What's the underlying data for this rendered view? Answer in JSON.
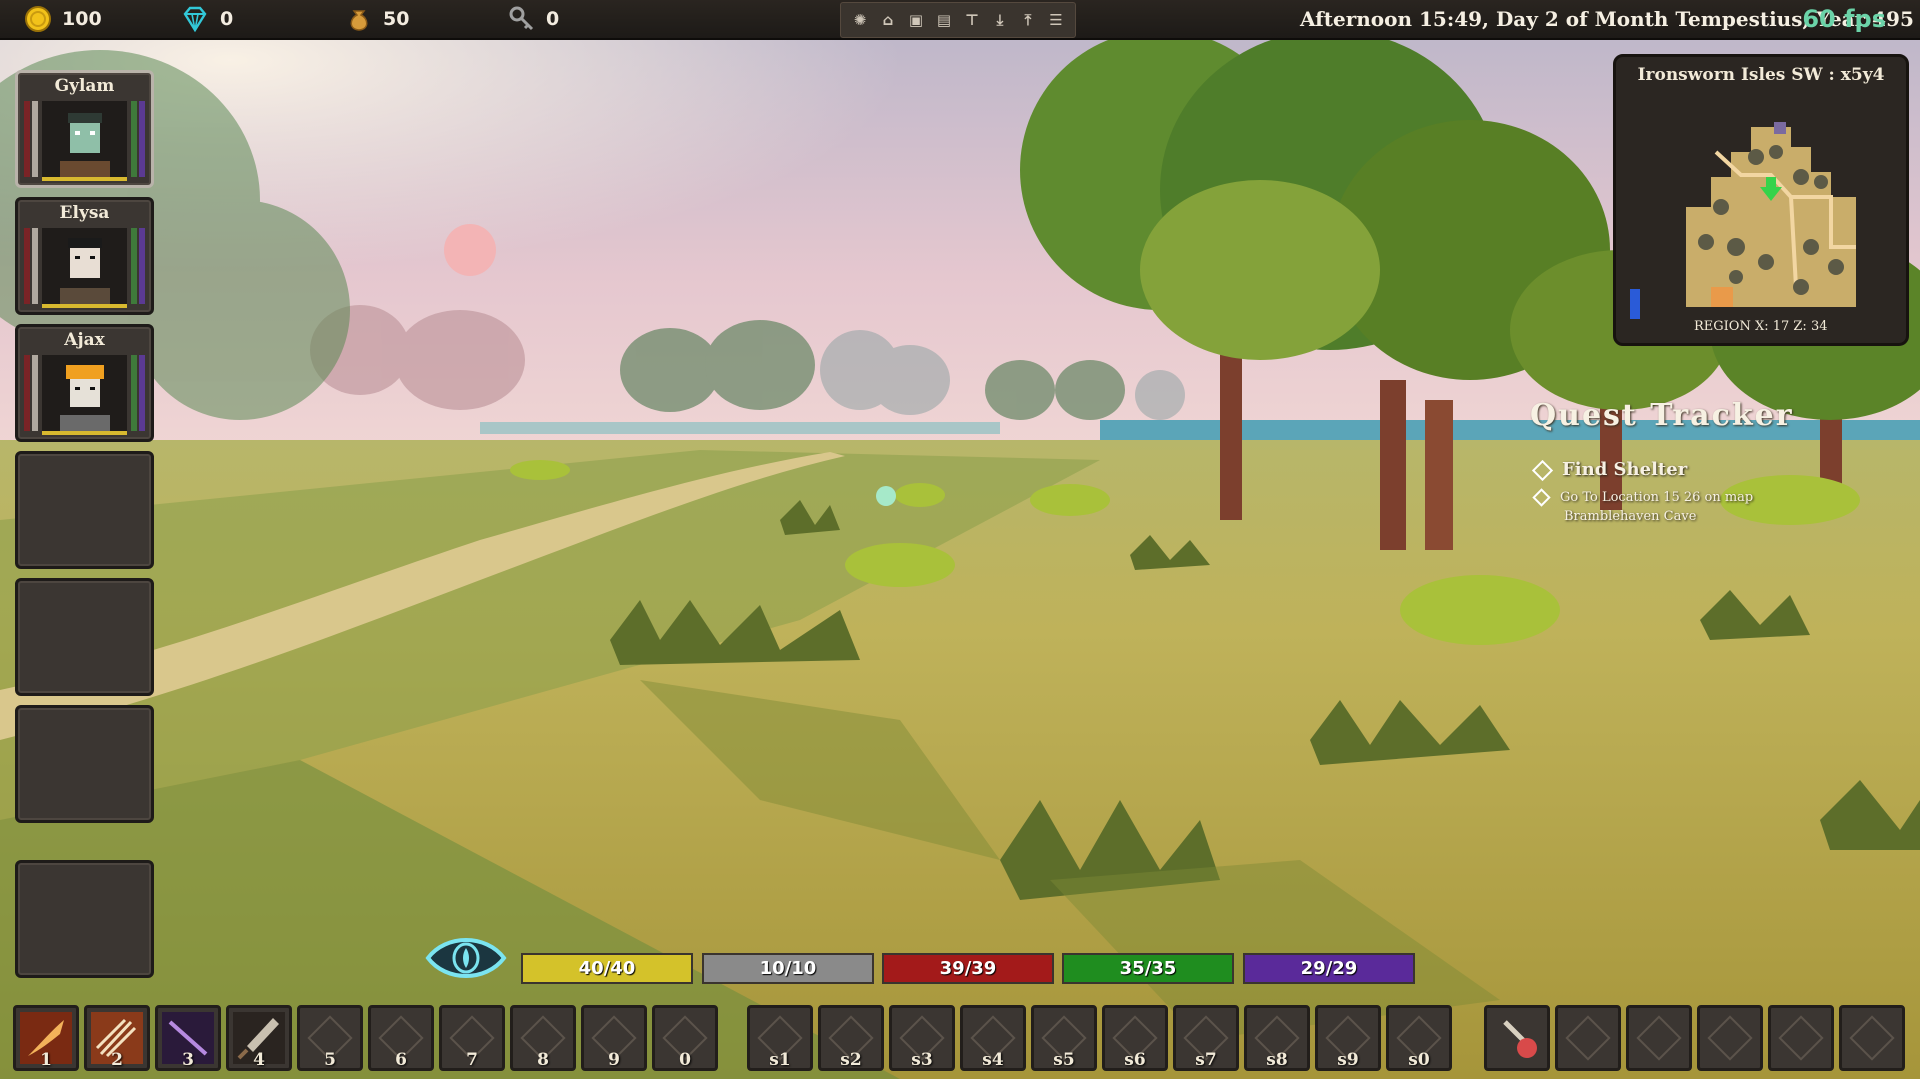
{
  "resources": [
    {
      "icon": "gold-coin-icon",
      "value": "100",
      "color": "#f2c21a"
    },
    {
      "icon": "diamond-icon",
      "value": "0",
      "color": "#32c8d8"
    },
    {
      "icon": "pouch-icon",
      "value": "50",
      "color": "#d79b3b"
    },
    {
      "icon": "key-icon",
      "value": "0",
      "color": "#a0a0a0"
    }
  ],
  "toolbar_icons": [
    "brain-icon",
    "home-icon",
    "chest-icon",
    "map-icon",
    "anvil-icon",
    "download-icon",
    "upload-icon",
    "settings-icon"
  ],
  "datetime": "Afternoon 15:49, Day 2 of Month Tempestius, Year 495",
  "fps": "60 fps",
  "party": [
    {
      "name": "Gylam",
      "selected": true
    },
    {
      "name": "Elysa",
      "selected": false
    },
    {
      "name": "Ajax",
      "selected": false
    }
  ],
  "minimap": {
    "title": "Ironsworn Isles SW : x5y4",
    "region": "REGION X: 17 Z: 34"
  },
  "quest_tracker": {
    "title": "Quest Tracker",
    "quest": "Find Shelter",
    "objective_line1": "Go To Location 15 26 on map",
    "objective_line2": "Bramblehaven Cave"
  },
  "stats": [
    {
      "value": "40/40",
      "color": "#d4c22a"
    },
    {
      "value": "10/10",
      "color": "#8a8a8a"
    },
    {
      "value": "39/39",
      "color": "#a31a1a"
    },
    {
      "value": "35/35",
      "color": "#1f8d1f"
    },
    {
      "value": "29/29",
      "color": "#5a2a9a"
    }
  ],
  "hotbar": {
    "actions": [
      "1",
      "2",
      "3",
      "4",
      "5",
      "6",
      "7",
      "8",
      "9",
      "0"
    ],
    "skills": [
      "s1",
      "s2",
      "s3",
      "s4",
      "s5",
      "s6",
      "s7",
      "s8",
      "s9",
      "s0"
    ]
  }
}
